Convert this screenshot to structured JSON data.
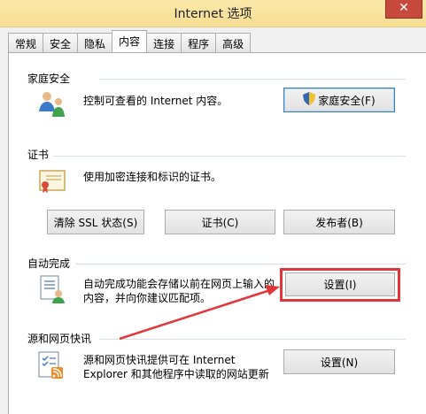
{
  "window": {
    "title": "Internet 选项",
    "close_glyph": "✕"
  },
  "tabs": [
    {
      "label": "常规"
    },
    {
      "label": "安全"
    },
    {
      "label": "隐私"
    },
    {
      "label": "内容",
      "active": true
    },
    {
      "label": "连接"
    },
    {
      "label": "程序"
    },
    {
      "label": "高级"
    }
  ],
  "family_safety": {
    "heading": "家庭安全",
    "description": "控制可查看的 Internet 内容。",
    "button": "家庭安全(F)"
  },
  "certificates": {
    "heading": "证书",
    "description": "使用加密连接和标识的证书。",
    "buttons": {
      "clear_ssl": "清除 SSL 状态(S)",
      "certificates": "证书(C)",
      "publishers": "发布者(B)"
    }
  },
  "autocomplete": {
    "heading": "自动完成",
    "description_line1": "自动完成功能会存储以前在网页上输入的",
    "description_line2": "内容，并向你建议匹配项。",
    "button": "设置(I)"
  },
  "feeds": {
    "heading": "源和网页快讯",
    "description_line1": "源和网页快讯提供可在 Internet",
    "description_line2": "Explorer 和其他程序中读取的网站更新",
    "button": "设置(N)"
  },
  "colors": {
    "annotation_red": "#e0383a",
    "titlebar": "#f6df94"
  }
}
